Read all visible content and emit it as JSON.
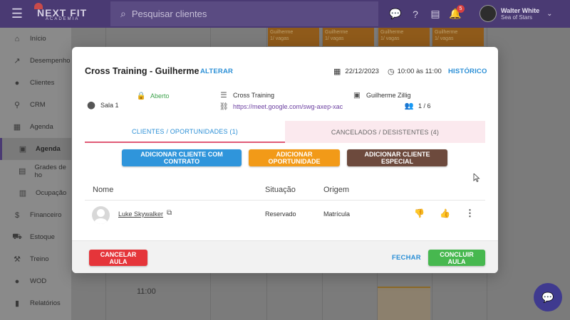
{
  "topbar": {
    "brand": "NEXT FIT",
    "brand_sub": "ACADEMIA",
    "search_placeholder": "Pesquisar clientes",
    "notification_count": "5",
    "user_name": "Walter White",
    "user_org": "Sea of Stars"
  },
  "sidebar": {
    "items": [
      {
        "label": "Início",
        "icon": "home-icon"
      },
      {
        "label": "Desempenho",
        "icon": "chart-icon"
      },
      {
        "label": "Clientes",
        "icon": "people-icon"
      },
      {
        "label": "CRM",
        "icon": "crm-icon"
      },
      {
        "label": "Agenda",
        "icon": "calendar-icon"
      },
      {
        "label": "Agenda",
        "icon": "calendar-icon"
      },
      {
        "label": "Grades de ho",
        "icon": "grid-icon"
      },
      {
        "label": "Ocupação",
        "icon": "calendar-icon"
      },
      {
        "label": "Financeiro",
        "icon": "money-icon"
      },
      {
        "label": "Estoque",
        "icon": "cart-icon"
      },
      {
        "label": "Treino",
        "icon": "training-icon"
      },
      {
        "label": "WOD",
        "icon": "kettlebell-icon"
      },
      {
        "label": "Relatórios",
        "icon": "report-icon"
      }
    ]
  },
  "calendar": {
    "events": [
      {
        "line1": "Guilherme",
        "line2": "1/ vagas"
      },
      {
        "line1": "Guilherme",
        "line2": "1/ vagas"
      },
      {
        "line1": "Guilherme",
        "line2": "1/ vagas"
      },
      {
        "line1": "Guilherme",
        "line2": "1/ vagas"
      }
    ],
    "hour_label": "11:00"
  },
  "modal": {
    "title": "Cross Training - Guilherme",
    "alter_label": "ALTERAR",
    "date": "22/12/2023",
    "time": "10:00 às 11:00",
    "history_label": "HISTÓRICO",
    "status": "Aberto",
    "room": "Sala 1",
    "modality": "Cross Training",
    "meet_link": "https://meet.google.com/swg-axep-xac",
    "teacher": "Guilherme Zillig",
    "capacity": "1 / 6",
    "tabs": [
      {
        "label": "CLIENTES / OPORTUNIDADES (1)"
      },
      {
        "label": "CANCELADOS / DESISTENTES (4)"
      }
    ],
    "actions": {
      "add_contract": "ADICIONAR CLIENTE COM CONTRATO",
      "add_opportunity": "ADICIONAR OPORTUNIDADE",
      "add_special": "ADICIONAR CLIENTE ESPECIAL"
    },
    "table": {
      "headers": {
        "name": "Nome",
        "status": "Situação",
        "origin": "Origem"
      },
      "rows": [
        {
          "name": "Luke Skywalker",
          "status": "Reservado",
          "origin": "Matrícula"
        }
      ]
    },
    "footer": {
      "cancel": "CANCELAR AULA",
      "close": "FECHAR",
      "finish": "CONCLUIR AULA"
    }
  },
  "colors": {
    "topbar": "#4a3a73",
    "accent_blue": "#2f95db",
    "orange": "#f29a18",
    "brown": "#6d4a3d",
    "red": "#e5353a",
    "green": "#47b84f"
  }
}
